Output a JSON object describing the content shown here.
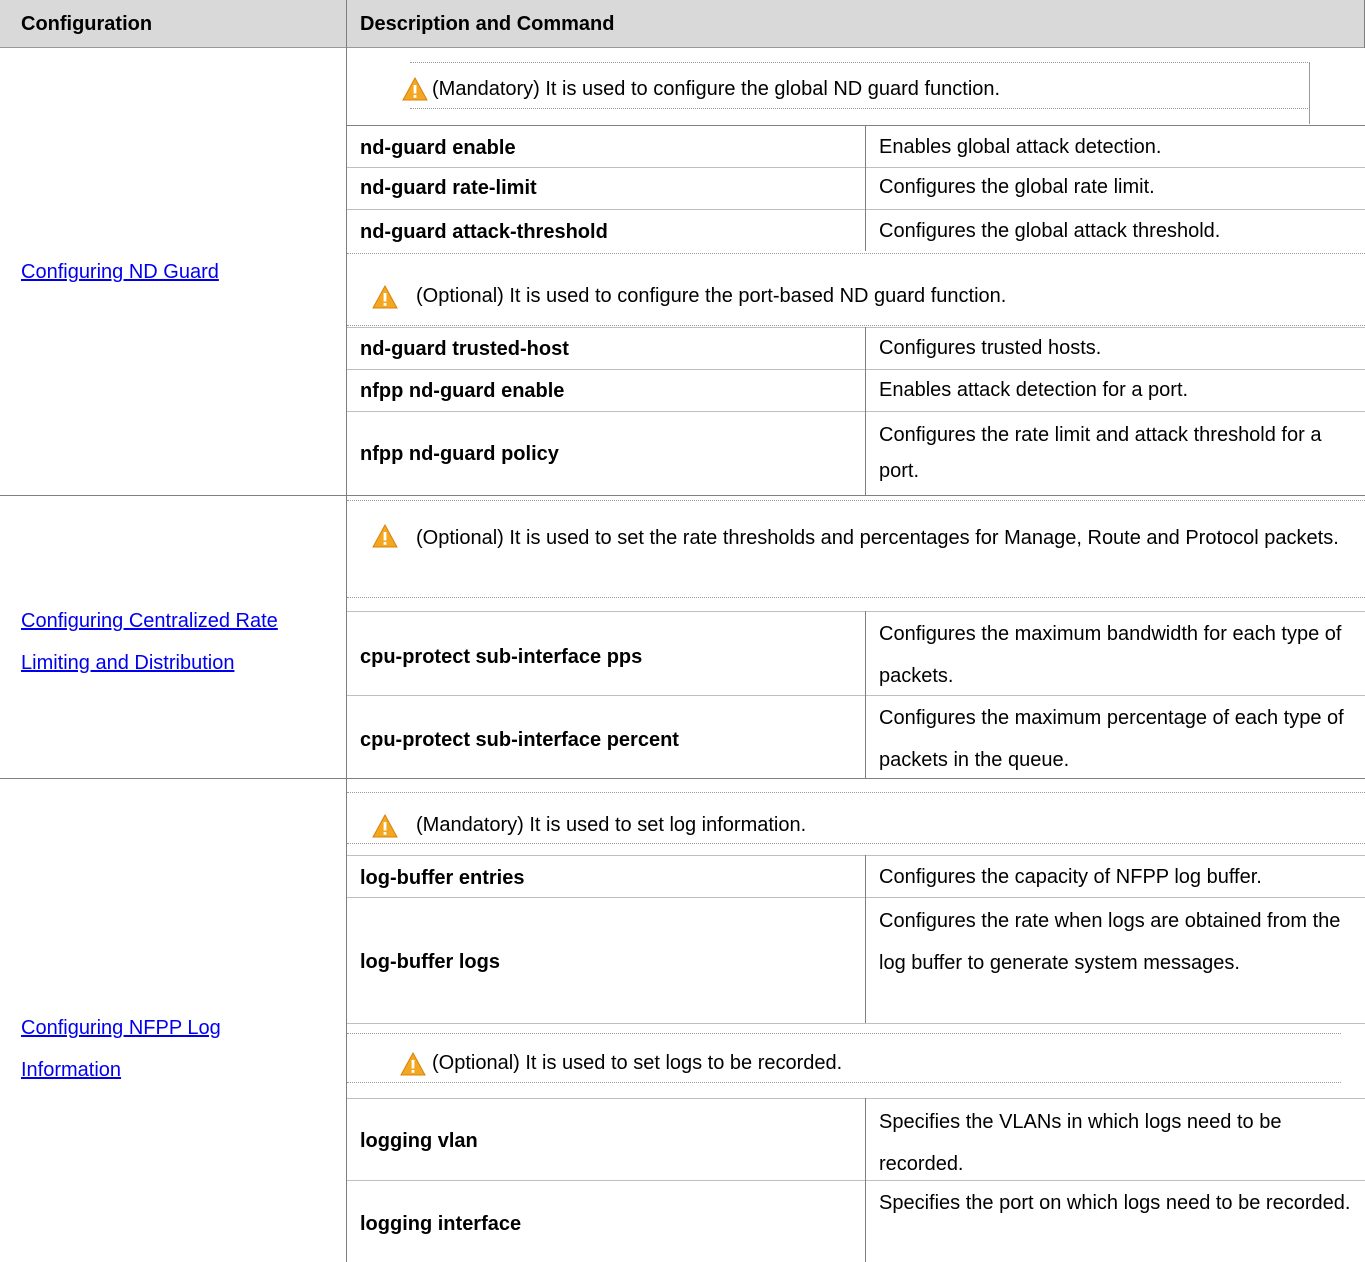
{
  "header": {
    "col1": "Configuration",
    "col2": "Description and Command"
  },
  "groups": [
    {
      "link": "Configuring ND Guard",
      "notes": [
        "(Mandatory) It is used to configure the global ND guard function.",
        "(Optional) It is used to configure the port-based ND guard function."
      ],
      "commands": [
        {
          "cmd": "nd-guard enable",
          "desc": "Enables global attack detection."
        },
        {
          "cmd": "nd-guard rate-limit",
          "desc": "Configures the global rate limit."
        },
        {
          "cmd": "nd-guard attack-threshold",
          "desc": "Configures the global attack threshold."
        },
        {
          "cmd": "nd-guard trusted-host",
          "desc": "Configures trusted hosts."
        },
        {
          "cmd": "nfpp nd-guard enable",
          "desc": "Enables attack detection for a port."
        },
        {
          "cmd": "nfpp nd-guard policy",
          "desc": "Configures the rate limit and attack threshold for a port."
        }
      ]
    },
    {
      "link": "Configuring Centralized Rate Limiting and Distribution",
      "notes": [
        "(Optional) It is used to set the rate thresholds and percentages for Manage, Route and Protocol packets."
      ],
      "commands": [
        {
          "cmd": "cpu-protect sub-interface pps",
          "desc": "Configures the maximum bandwidth for each type of packets."
        },
        {
          "cmd": "cpu-protect sub-interface percent",
          "desc": "Configures the maximum percentage of each type of packets in the queue."
        }
      ]
    },
    {
      "link": "Configuring NFPP Log Information",
      "notes": [
        "(Mandatory) It is used to set log information.",
        "(Optional) It is used to set logs to be recorded."
      ],
      "commands": [
        {
          "cmd": "log-buffer entries",
          "desc": "Configures the capacity of NFPP log buffer."
        },
        {
          "cmd": "log-buffer logs",
          "desc": "Configures the rate when logs are obtained from the log buffer to generate system messages."
        },
        {
          "cmd": "logging vlan",
          "desc": "Specifies the VLANs in which logs need to be recorded."
        },
        {
          "cmd": "logging interface",
          "desc": "Specifies the port on which logs need to be recorded."
        }
      ]
    }
  ],
  "colors": {
    "header_bg": "#d9d9d9",
    "link": "#0000ee",
    "warning_fill": "#f5a623"
  },
  "icons": [
    "warning-icon"
  ]
}
